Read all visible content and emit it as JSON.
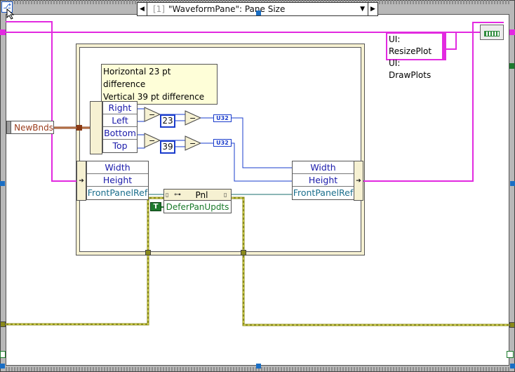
{
  "frame": {
    "selector_index": "[1]",
    "selector_label": "\"WaveformPane\": Pane Size",
    "left_arrow_icon": "triangle-left",
    "right_arrow_icon": "triangle-right",
    "dropdown_icon": "triangle-down"
  },
  "event_data": {
    "terminal_label": "NewBnds"
  },
  "comment": {
    "line1": "Horizontal 23 pt difference",
    "line2": "Vertical 39 pt difference"
  },
  "unbundle_left": {
    "items": [
      "Right",
      "Left",
      "Bottom",
      "Top"
    ]
  },
  "subtract_op": "−",
  "constants": {
    "horizontal": "23",
    "vertical": "39"
  },
  "conversion_label": "U32",
  "unbundle_panel": {
    "items": [
      "Width",
      "Height",
      "FrontPanelRef"
    ]
  },
  "bundle_panel": {
    "items": [
      "Width",
      "Height",
      "FrontPanelRef"
    ]
  },
  "property_node": {
    "class": "Pnl",
    "property": "DeferPanUpdts",
    "constant": "T"
  },
  "ui_messages": [
    "UI: ResizePlot",
    "UI: DrawPlots"
  ],
  "colors": {
    "wire_cluster": "#e22ae0",
    "wire_numeric": "#1a3ccc",
    "wire_refnum": "#1a6e6e",
    "wire_error": "#8a8a1a",
    "wire_bounds": "#8a3a14"
  }
}
